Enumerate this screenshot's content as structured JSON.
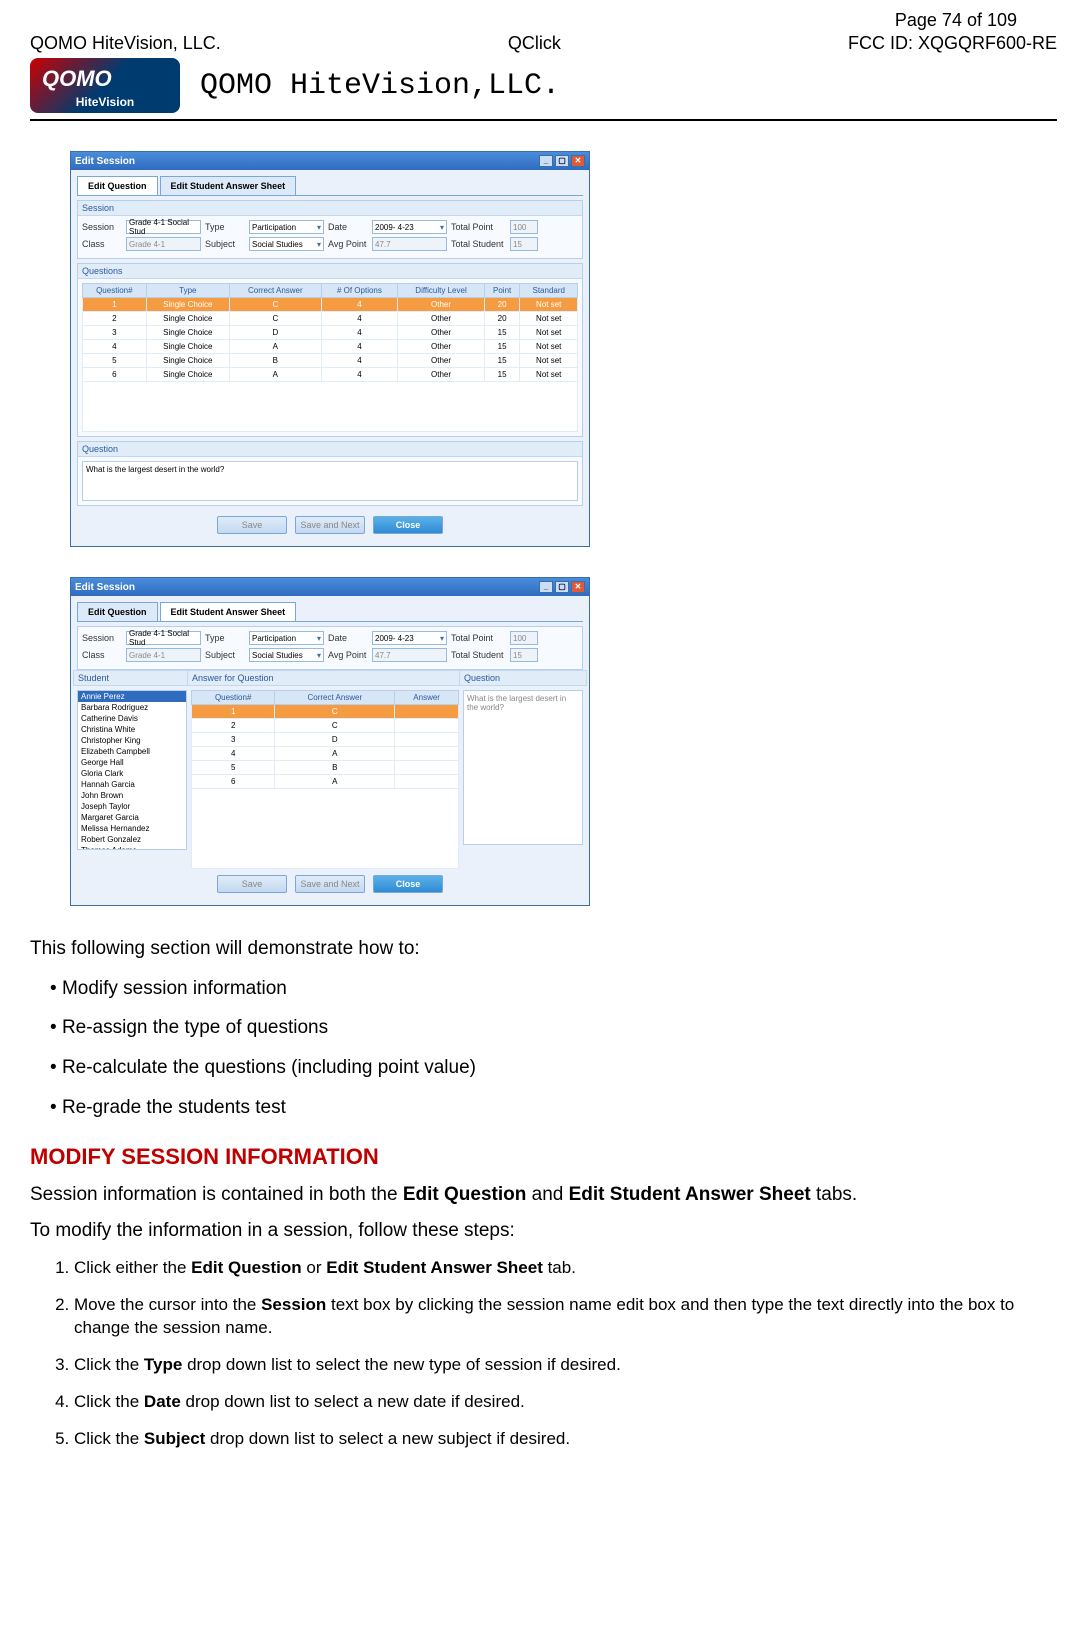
{
  "page": {
    "num_label": "Page 74 of 109",
    "left": "QOMO HiteVision, LLC.",
    "center": "QClick",
    "right": "FCC ID: XQGQRF600-RE"
  },
  "logo": {
    "sub": "HiteVision",
    "brand": "QOMO HiteVision,LLC."
  },
  "win1": {
    "title": "Edit Session",
    "tabs": [
      "Edit Question",
      "Edit Student Answer Sheet"
    ],
    "active_tab": 0,
    "sess": {
      "session_lbl": "Session",
      "session": "Grade 4-1 Social Stud",
      "type_lbl": "Type",
      "type": "Participation",
      "date_lbl": "Date",
      "date": "2009- 4-23",
      "total_point_lbl": "Total Point",
      "total_point": "100",
      "class_lbl": "Class",
      "class": "Grade 4-1",
      "subject_lbl": "Subject",
      "subject": "Social Studies",
      "avg_lbl": "Avg Point",
      "avg": "47.7",
      "total_stud_lbl": "Total Student",
      "total_stud": "15"
    },
    "q_headers": [
      "Question#",
      "Type",
      "Correct Answer",
      "# Of Options",
      "Difficulty Level",
      "Point",
      "Standard"
    ],
    "q_rows": [
      {
        "n": "1",
        "type": "Single Choice",
        "ans": "C",
        "opts": "4",
        "diff": "Other",
        "pt": "20",
        "std": "Not set",
        "sel": true
      },
      {
        "n": "2",
        "type": "Single Choice",
        "ans": "C",
        "opts": "4",
        "diff": "Other",
        "pt": "20",
        "std": "Not set"
      },
      {
        "n": "3",
        "type": "Single Choice",
        "ans": "D",
        "opts": "4",
        "diff": "Other",
        "pt": "15",
        "std": "Not set"
      },
      {
        "n": "4",
        "type": "Single Choice",
        "ans": "A",
        "opts": "4",
        "diff": "Other",
        "pt": "15",
        "std": "Not set"
      },
      {
        "n": "5",
        "type": "Single Choice",
        "ans": "B",
        "opts": "4",
        "diff": "Other",
        "pt": "15",
        "std": "Not set"
      },
      {
        "n": "6",
        "type": "Single Choice",
        "ans": "A",
        "opts": "4",
        "diff": "Other",
        "pt": "15",
        "std": "Not set"
      }
    ],
    "question_group": "Question",
    "question_text": "What is the largest desert in the world?",
    "btns": {
      "save": "Save",
      "save_next": "Save and Next",
      "close": "Close"
    }
  },
  "win2": {
    "title": "Edit Session",
    "tabs": [
      "Edit Question",
      "Edit Student Answer Sheet"
    ],
    "active_tab": 1,
    "student_header": "Student",
    "ans_header": "Answer for Question",
    "q_header": "Question",
    "students": [
      "Annie Perez",
      "Barbara Rodriguez",
      "Catherine Davis",
      "Christina White",
      "Christopher King",
      "Elizabeth Campbell",
      "George Hall",
      "Gloria Clark",
      "Hannah Garcia",
      "John Brown",
      "Joseph Taylor",
      "Margaret Garcia",
      "Melissa Hernandez",
      "Robert Gonzalez",
      "Thomas Adams"
    ],
    "ans_cols": [
      "Question#",
      "Correct Answer",
      "Answer"
    ],
    "ans_rows": [
      {
        "n": "1",
        "ca": "C",
        "a": "",
        "sel": true
      },
      {
        "n": "2",
        "ca": "C",
        "a": ""
      },
      {
        "n": "3",
        "ca": "D",
        "a": ""
      },
      {
        "n": "4",
        "ca": "A",
        "a": ""
      },
      {
        "n": "5",
        "ca": "B",
        "a": ""
      },
      {
        "n": "6",
        "ca": "A",
        "a": ""
      }
    ],
    "qprev": "What is the largest desert in the world?",
    "btns": {
      "save": "Save",
      "save_next": "Save and Next",
      "close": "Close"
    }
  },
  "doc": {
    "intro": "This following section will demonstrate how to:",
    "bullets": [
      "Modify session information",
      "Re-assign the type of questions",
      "Re-calculate the questions (including point value)",
      "Re-grade the students test"
    ],
    "h2": "MODIFY SESSION INFORMATION",
    "p1a": "Session information is contained in both the ",
    "p1b": "Edit Question",
    "p1c": " and ",
    "p1d": "Edit Student Answer Sheet",
    "p1e": " tabs.",
    "p2": "To modify the information in a session, follow these steps:",
    "steps": [
      {
        "pre": "Click either the ",
        "b1": "Edit Question",
        "mid": " or ",
        "b2": "Edit Student Answer Sheet",
        "post": " tab."
      },
      {
        "pre": "Move the cursor into the ",
        "b1": "Session",
        "mid": "",
        "b2": "",
        "post": " text box by clicking the session name edit box and then type the text directly into the box to change the session name."
      },
      {
        "pre": "Click the ",
        "b1": "Type",
        "mid": "",
        "b2": "",
        "post": " drop down list to select the new type of session if desired."
      },
      {
        "pre": "Click the ",
        "b1": "Date",
        "mid": "",
        "b2": "",
        "post": " drop down list to select a new date if desired."
      },
      {
        "pre": "Click the ",
        "b1": "Subject",
        "mid": "",
        "b2": "",
        "post": " drop down list to select a new subject if desired."
      }
    ]
  }
}
